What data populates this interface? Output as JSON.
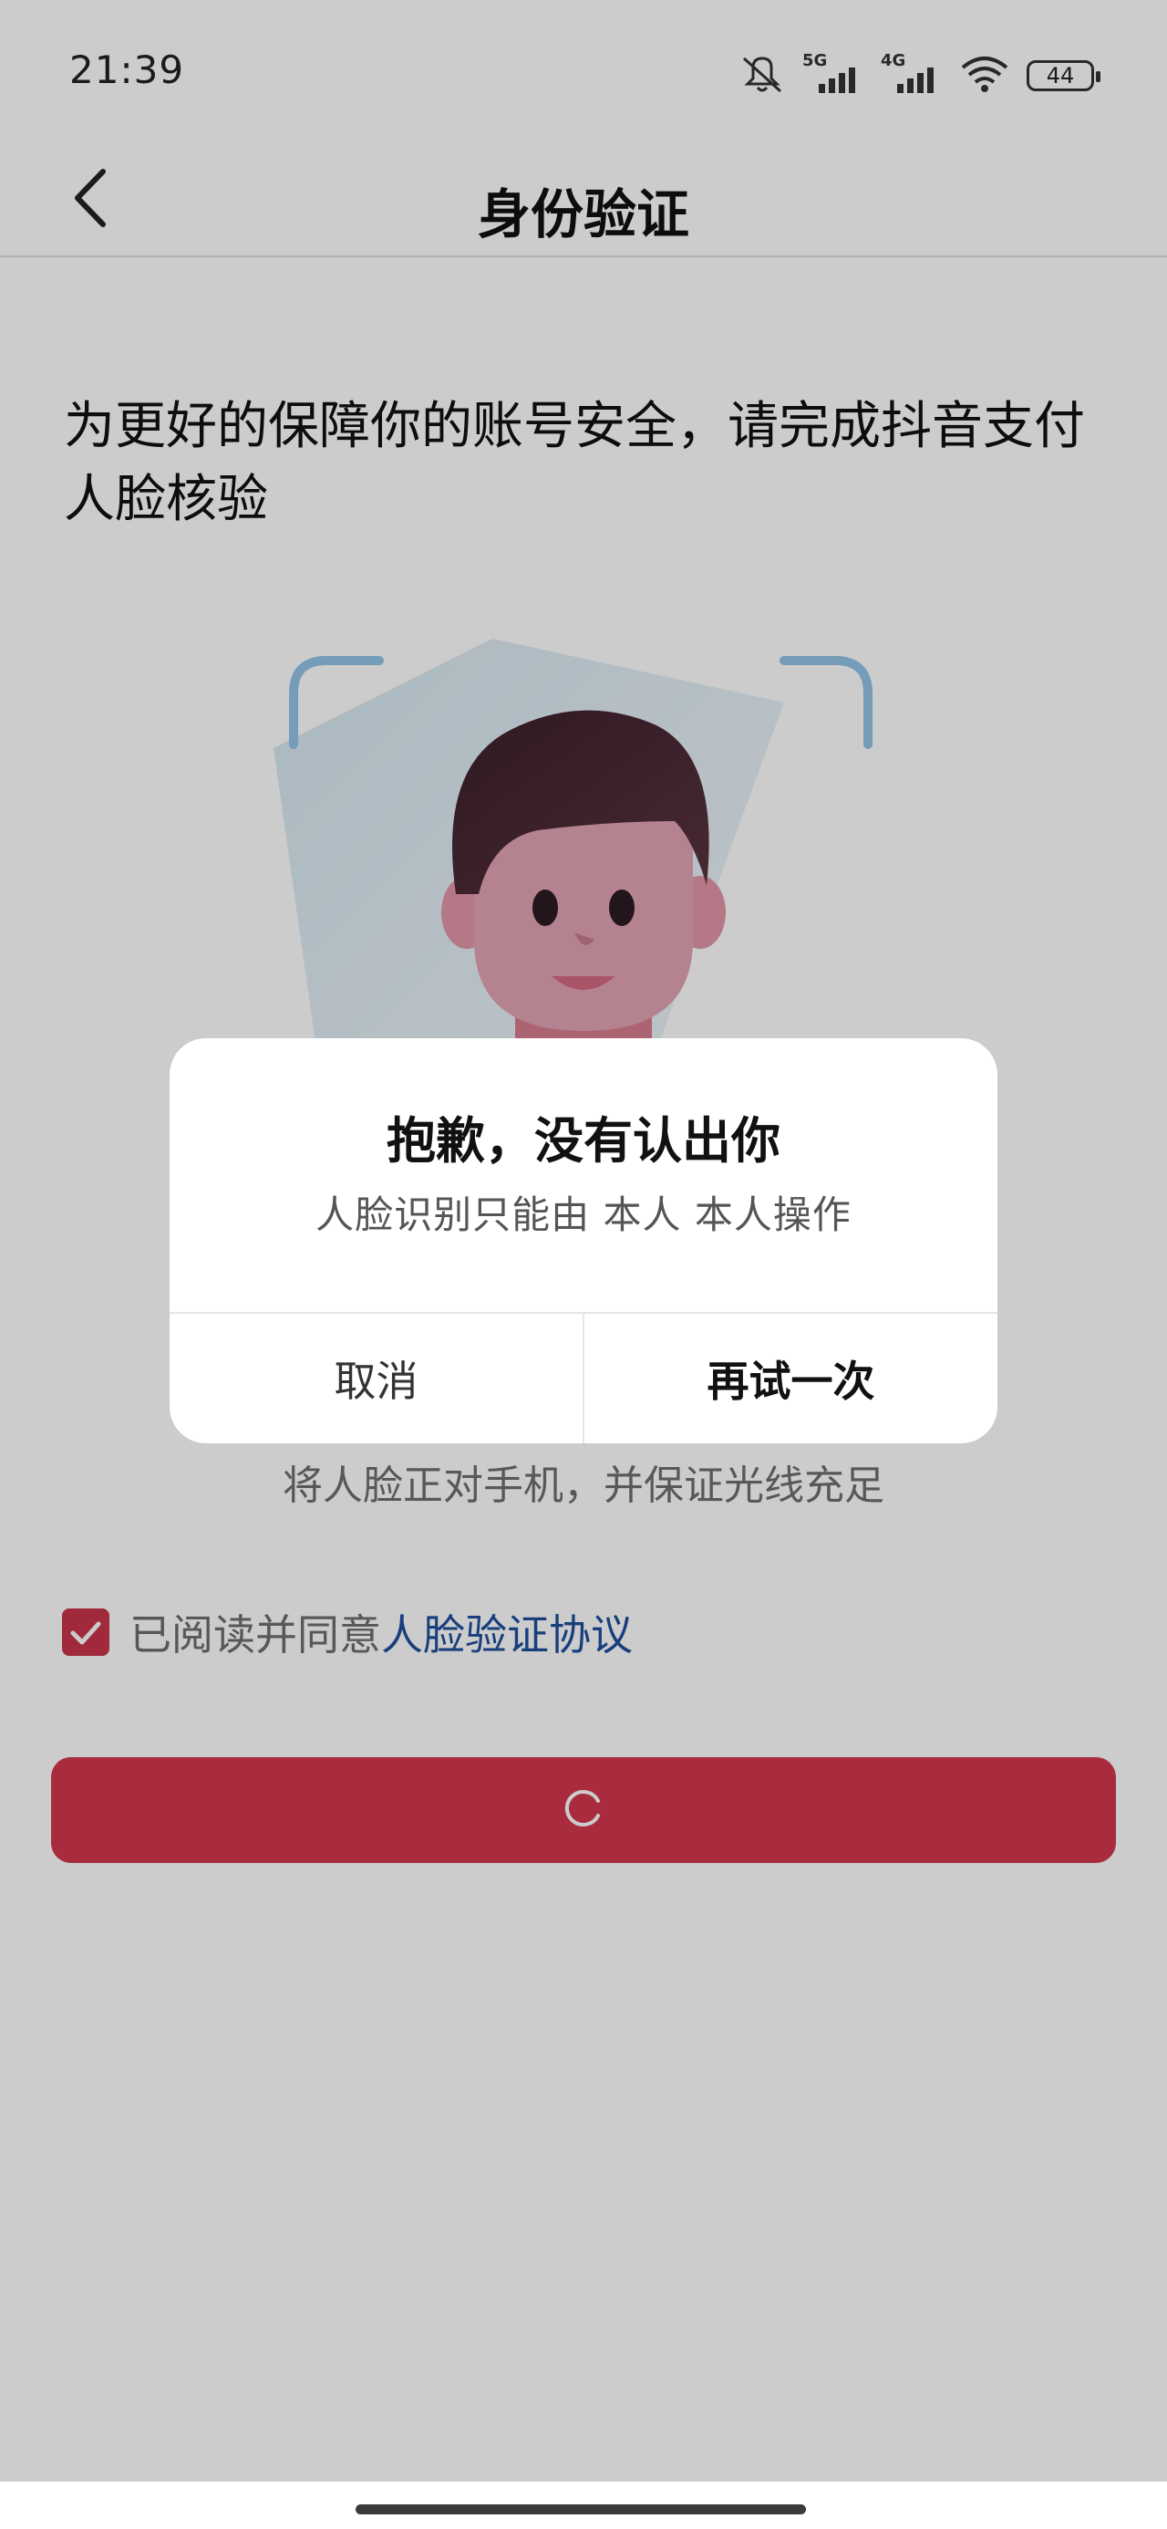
{
  "status_bar": {
    "time": "21:39",
    "network_1": "5G",
    "network_2": "4G",
    "battery": "44",
    "icons": [
      "mute-icon",
      "signal-5g-icon",
      "signal-4g-icon",
      "wifi-icon",
      "battery-icon"
    ]
  },
  "nav": {
    "title": "身份验证",
    "back_icon": "back-chevron-icon"
  },
  "instruction": "为更好的保障你的账号安全，请完成抖音支付人脸核验",
  "hint": "将人脸正对手机，并保证光线充足",
  "agreement": {
    "checked": true,
    "text": "已阅读并同意",
    "link": "人脸验证协议"
  },
  "primary_button": {
    "state": "loading",
    "icon": "loading-spinner-icon"
  },
  "dialog": {
    "title": "抱歉，没有认出你",
    "message": "人脸识别只能由 本人 本人操作",
    "cancel_label": "取消",
    "retry_label": "再试一次"
  },
  "colors": {
    "accent": "#d2384e",
    "link": "#1f4f9c",
    "overlay": "rgba(0,0,0,0.2)"
  }
}
